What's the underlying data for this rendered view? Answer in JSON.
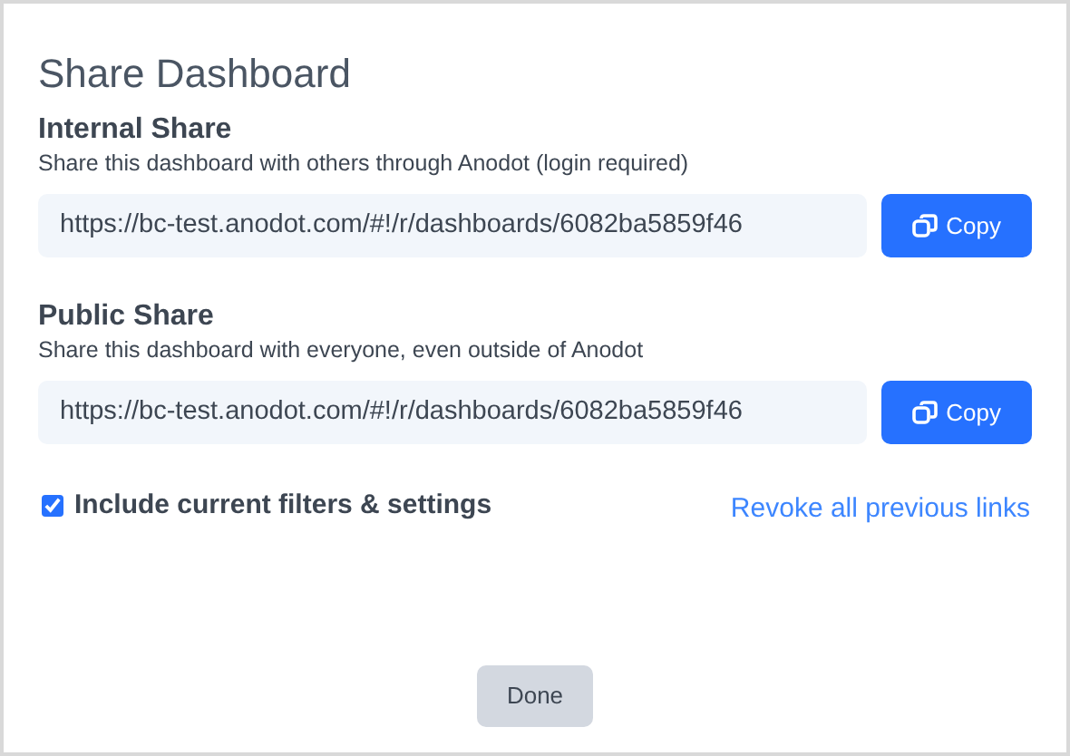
{
  "dialog": {
    "title": "Share Dashboard"
  },
  "shares": [
    {
      "title": "Internal Share",
      "description": "Share this dashboard with others through Anodot (login required)",
      "url": "https://bc-test.anodot.com/#!/r/dashboards/6082ba5859f46",
      "button": "Copy"
    },
    {
      "title": "Public Share",
      "description": "Share this dashboard with everyone, even outside of Anodot",
      "url": "https://bc-test.anodot.com/#!/r/dashboards/6082ba5859f46",
      "button": "Copy"
    }
  ],
  "include_filters": {
    "label": "Include current filters & settings",
    "checked": true
  },
  "revoke_link": "Revoke all previous links",
  "buttons": [
    "Done"
  ]
}
